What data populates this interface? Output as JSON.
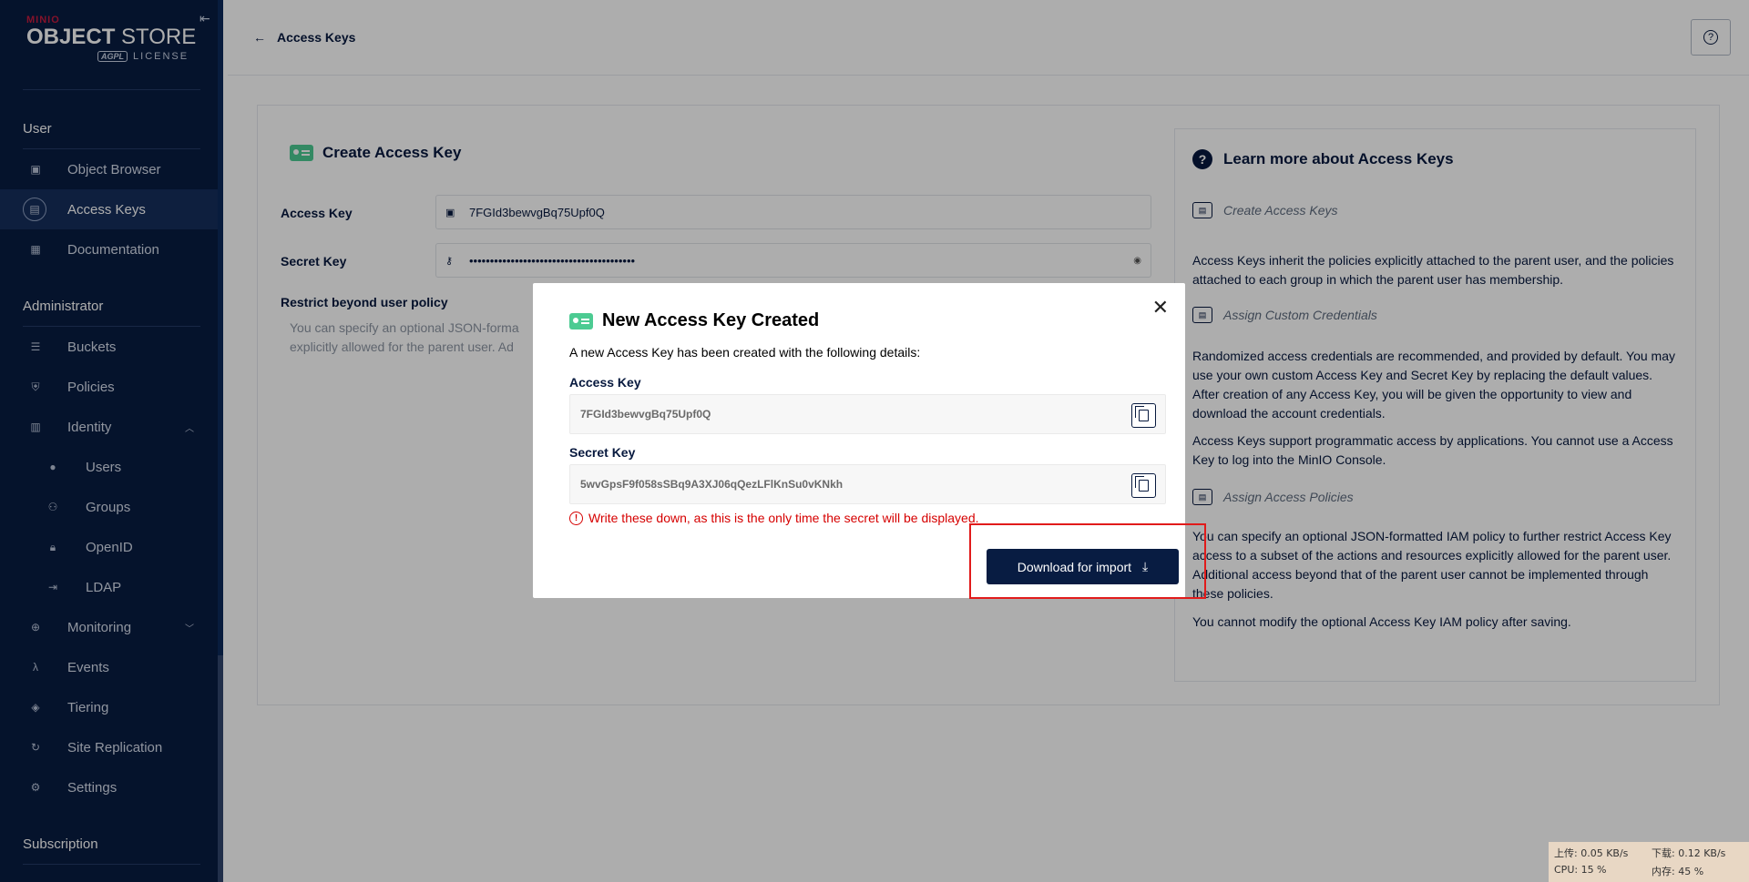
{
  "sidebar": {
    "logo": {
      "brand": "MINIO",
      "product_bold": "OBJECT",
      "product_light": " STORE",
      "license_badge": "AGPL",
      "license_text": "LICENSE"
    },
    "sections": [
      {
        "label": "User"
      },
      {
        "label": "Administrator"
      },
      {
        "label": "Subscription"
      }
    ],
    "user_items": [
      {
        "label": "Object Browser",
        "icon": "object-browser-icon"
      },
      {
        "label": "Access Keys",
        "icon": "access-keys-icon",
        "active": true
      },
      {
        "label": "Documentation",
        "icon": "documentation-icon"
      }
    ],
    "admin_items": [
      {
        "label": "Buckets",
        "icon": "buckets-icon"
      },
      {
        "label": "Policies",
        "icon": "policies-icon"
      },
      {
        "label": "Identity",
        "icon": "identity-icon",
        "expanded": true
      },
      {
        "label": "Users",
        "icon": "users-icon"
      },
      {
        "label": "Groups",
        "icon": "groups-icon"
      },
      {
        "label": "OpenID",
        "icon": "openid-icon"
      },
      {
        "label": "LDAP",
        "icon": "ldap-icon"
      },
      {
        "label": "Monitoring",
        "icon": "monitoring-icon"
      },
      {
        "label": "Events",
        "icon": "events-icon"
      },
      {
        "label": "Tiering",
        "icon": "tiering-icon"
      },
      {
        "label": "Site Replication",
        "icon": "site-replication-icon"
      },
      {
        "label": "Settings",
        "icon": "settings-icon"
      }
    ]
  },
  "header": {
    "back_label": "Access Keys"
  },
  "form": {
    "title": "Create Access Key",
    "access_key_label": "Access Key",
    "access_key_value": "7FGId3bewvgBq75Upf0Q",
    "secret_key_label": "Secret Key",
    "secret_key_masked": "••••••••••••••••••••••••••••••••••••••••",
    "restrict_heading": "Restrict beyond user policy",
    "restrict_text_1": "You can specify an optional JSON-forma",
    "restrict_text_2": "explicitly allowed for the parent user. Ad"
  },
  "learn": {
    "title": "Learn more about Access Keys",
    "sub1": "Create Access Keys",
    "p1": "Access Keys inherit the policies explicitly attached to the parent user, and the policies attached to each group in which the parent user has membership.",
    "sub2": "Assign Custom Credentials",
    "p2": "Randomized access credentials are recommended, and provided by default. You may use your own custom Access Key and Secret Key by replacing the default values. After creation of any Access Key, you will be given the opportunity to view and download the account credentials.",
    "p3": "Access Keys support programmatic access by applications. You cannot use a Access Key to log into the MinIO Console.",
    "sub3": "Assign Access Policies",
    "p4": "You can specify an optional JSON-formatted IAM policy to further restrict Access Key access to a subset of the actions and resources explicitly allowed for the parent user. Additional access beyond that of the parent user cannot be implemented through these policies.",
    "p5": "You cannot modify the optional Access Key IAM policy after saving."
  },
  "modal": {
    "title": "New Access Key Created",
    "description": "A new Access Key has been created with the following details:",
    "access_key_label": "Access Key",
    "access_key_value": "7FGId3bewvgBq75Upf0Q",
    "secret_key_label": "Secret Key",
    "secret_key_value": "5wvGpsF9f058sSBq9A3XJ06qQezLFlKnSu0vKNkh",
    "warning": "Write these down, as this is the only time the secret will be displayed.",
    "download_label": "Download for import"
  },
  "tray": {
    "upload": "上传: 0.05 KB/s",
    "download": "下载: 0.12 KB/s",
    "cpu": "CPU: 15 %",
    "memory": "内存: 45 %"
  },
  "colors": {
    "sidebar_bg": "#081c42",
    "accent_green": "#4ccb92",
    "warning_red": "#d60000",
    "highlight_red": "#e11b1b"
  }
}
